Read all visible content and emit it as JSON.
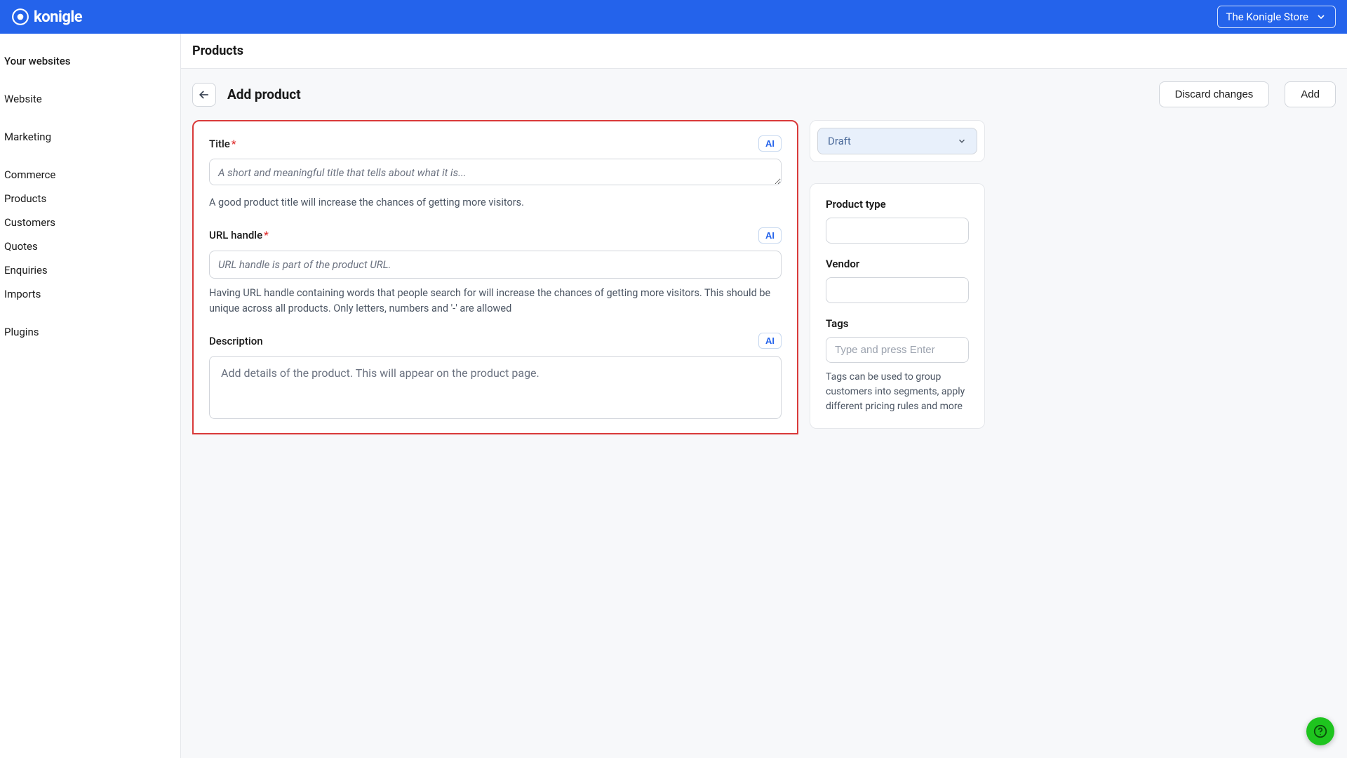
{
  "brand": "konigle",
  "store_name": "The Konigle Store",
  "sidebar": {
    "heading_websites": "Your websites",
    "item_website": "Website",
    "item_marketing": "Marketing",
    "item_commerce": "Commerce",
    "item_products": "Products",
    "item_customers": "Customers",
    "item_quotes": "Quotes",
    "item_enquiries": "Enquiries",
    "item_imports": "Imports",
    "item_plugins": "Plugins"
  },
  "page": {
    "title": "Products",
    "subtitle": "Add product",
    "discard_label": "Discard changes",
    "add_label": "Add"
  },
  "form": {
    "title_label": "Title",
    "title_placeholder": "A short and meaningful title that tells about what it is...",
    "title_ai": "AI",
    "title_hint": "A good product title will increase the chances of getting more visitors.",
    "url_label": "URL handle",
    "url_placeholder": "URL handle is part of the product URL.",
    "url_ai": "AI",
    "url_hint": "Having URL handle containing words that people search for will increase the chances of getting more visitors. This should be unique across all products. Only letters, numbers and '-' are allowed",
    "desc_label": "Description",
    "desc_ai": "AI",
    "desc_placeholder": "Add details of the product. This will appear on the product page."
  },
  "status": {
    "value": "Draft"
  },
  "right": {
    "product_type_label": "Product type",
    "vendor_label": "Vendor",
    "tags_label": "Tags",
    "tags_placeholder": "Type and press Enter",
    "tags_hint": "Tags can be used to group customers into segments, apply different pricing rules and more"
  }
}
